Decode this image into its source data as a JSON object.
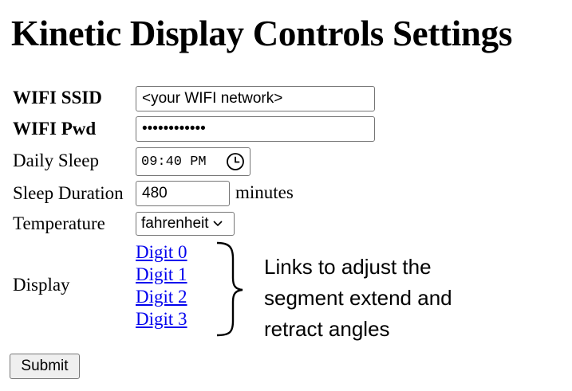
{
  "page": {
    "title": "Kinetic Display Controls Settings"
  },
  "form": {
    "wifi_ssid": {
      "label": "WIFI SSID",
      "value": "<your WIFI network>"
    },
    "wifi_pwd": {
      "label": "WIFI Pwd",
      "value": "••••••••••••"
    },
    "daily_sleep": {
      "label": "Daily Sleep",
      "value": "09:40 PM",
      "icon": "clock-icon"
    },
    "sleep_duration": {
      "label": "Sleep Duration",
      "value": "480",
      "unit": "minutes"
    },
    "temperature": {
      "label": "Temperature",
      "selected": "fahrenheit",
      "icon": "chevron-down-icon"
    },
    "display": {
      "label": "Display",
      "links": [
        "Digit 0",
        "Digit 1",
        "Digit 2",
        "Digit 3"
      ]
    },
    "submit_label": "Submit"
  },
  "annotation": {
    "lines": [
      "Links to adjust the",
      "segment extend and",
      "retract angles"
    ],
    "icon": "curly-brace-icon"
  },
  "colors": {
    "link": "#0000ee",
    "border": "#767676",
    "button_bg": "#efefef"
  }
}
